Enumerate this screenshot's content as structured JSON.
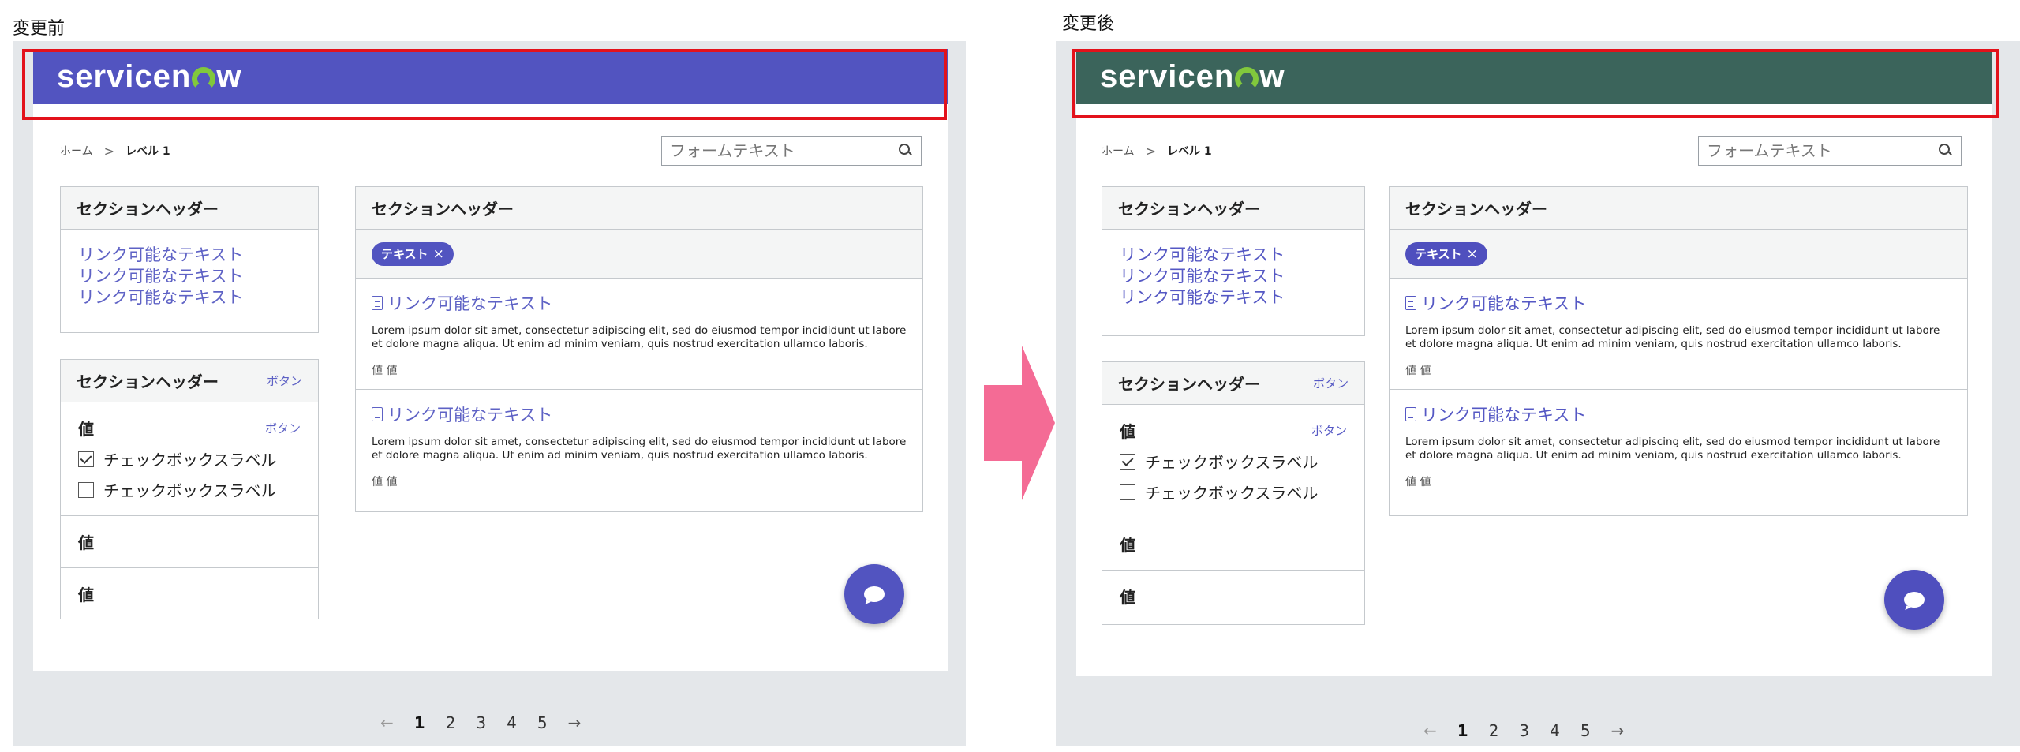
{
  "captions": {
    "before": "変更前",
    "after": "変更後"
  },
  "colors": {
    "before_header": "#5254c0",
    "after_header": "#3b645b",
    "before_accent": "#5254c0",
    "after_accent": "#4f4fbe",
    "link_before": "#5e62c5",
    "link_after": "#5558c4",
    "logo_green": "#81c83c",
    "highlight": "#e3121b",
    "transition_arrow": "#f46b95"
  },
  "app": {
    "logo_text_pre": "servicen",
    "logo_text_post": "w",
    "breadcrumb": {
      "home": "ホーム",
      "separator": ">",
      "current": "レベル 1"
    },
    "search": {
      "placeholder": "フォームテキスト",
      "icon": "search-icon"
    },
    "left_section1": {
      "title": "セクションヘッダー",
      "links": [
        "リンク可能なテキスト",
        "リンク可能なテキスト",
        "リンク可能なテキスト"
      ]
    },
    "left_section2": {
      "title": "セクションヘッダー",
      "header_button": "ボタン",
      "rows": [
        {
          "value": "値",
          "button": "ボタン",
          "checkboxes": [
            {
              "label": "チェックボックスラベル",
              "checked": true
            },
            {
              "label": "チェックボックスラベル",
              "checked": false
            }
          ]
        },
        {
          "value": "値"
        },
        {
          "value": "値"
        }
      ]
    },
    "right_section": {
      "title": "セクションヘッダー",
      "tag": {
        "label": "テキスト",
        "close": "×"
      },
      "items": [
        {
          "title": "リンク可能なテキスト",
          "body": "Lorem ipsum dolor sit amet, consectetur adipiscing elit, sed do eiusmod tempor incididunt ut labore et dolore magna aliqua. Ut enim ad minim veniam, quis nostrud exercitation ullamco laboris.",
          "meta": "値 値"
        },
        {
          "title": "リンク可能なテキスト",
          "body": "Lorem ipsum dolor sit amet, consectetur adipiscing elit, sed do eiusmod tempor incididunt ut labore et dolore magna aliqua. Ut enim ad minim veniam, quis nostrud exercitation ullamco laboris.",
          "meta": "値 値"
        }
      ]
    },
    "chat_icon": "chat-bubble-icon",
    "pagination": {
      "prev": "←",
      "pages": [
        "1",
        "2",
        "3",
        "4",
        "5"
      ],
      "active": "1",
      "next": "→"
    }
  }
}
